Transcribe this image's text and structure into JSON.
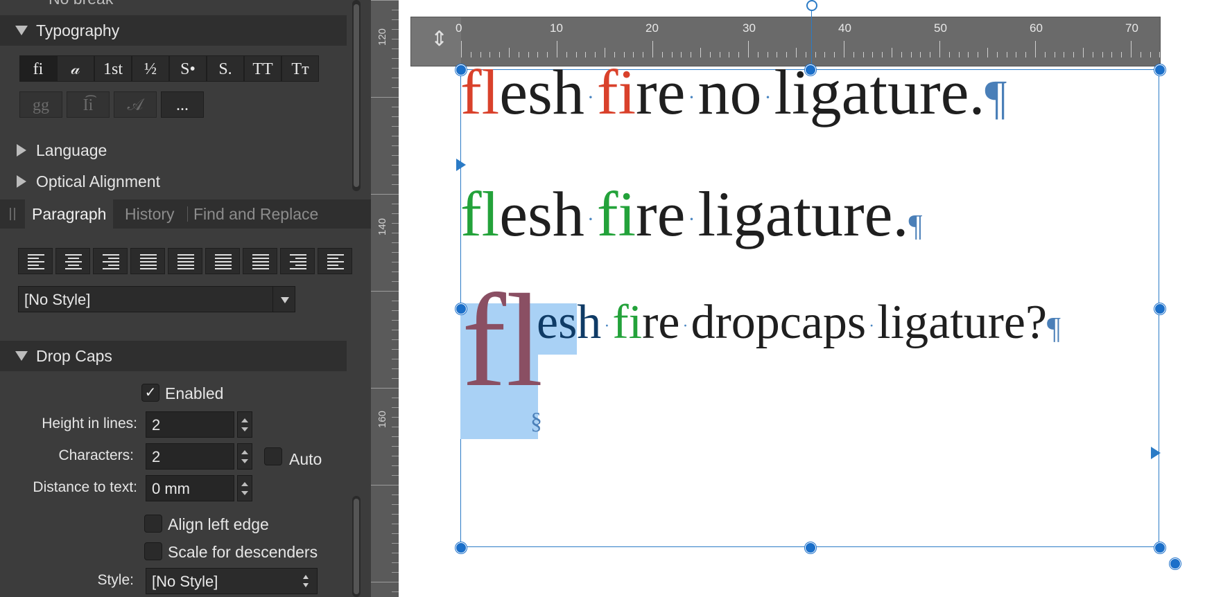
{
  "panel": {
    "top_cut_label": "No break",
    "typography": {
      "title": "Typography",
      "buttons_row1": [
        "fi",
        "𝒶",
        "1st",
        "½",
        "S•",
        "S.",
        "TT",
        "Tт"
      ],
      "buttons_row2": [
        "gg",
        "I͡i",
        "𝒜",
        "..."
      ]
    },
    "language": "Language",
    "optical_alignment": "Optical Alignment",
    "tabs": [
      "Paragraph",
      "History",
      "Find and Replace"
    ],
    "style_select": "[No Style]",
    "drop_caps": {
      "title": "Drop Caps",
      "enabled_label": "Enabled",
      "height_label": "Height in lines:",
      "height_value": "2",
      "characters_label": "Characters:",
      "characters_value": "2",
      "auto_label": "Auto",
      "distance_label": "Distance to text:",
      "distance_value": "0 mm",
      "align_left_label": "Align left edge",
      "scale_desc_label": "Scale for descenders",
      "style_label": "Style:",
      "style_value": "[No Style]"
    }
  },
  "ruler": {
    "vertical": [
      "120",
      "140",
      "160"
    ],
    "horizontal": [
      "0",
      "10",
      "20",
      "30",
      "40",
      "50",
      "60",
      "70"
    ]
  },
  "document": {
    "line1": {
      "lig1": "fl",
      "w1": "esh",
      "lig2": "fi",
      "w2": "re",
      "w3": "no",
      "w4": "ligature."
    },
    "line2": {
      "lig1": "fl",
      "w1": "esh",
      "lig2": "fi",
      "w2": "re",
      "w3": "ligature."
    },
    "line3": {
      "dropcap": "fl",
      "w1": "esh",
      "lig2": "fi",
      "w2": "re",
      "w3": "dropcaps",
      "w4": "ligature?"
    },
    "pilcrow": "¶",
    "section": "§"
  },
  "colors": {
    "red": "#d9412b",
    "green": "#23a23a",
    "dropcap": "#8a4f63",
    "highlight": "#a9d1f5",
    "frame": "#2b7bc6"
  }
}
